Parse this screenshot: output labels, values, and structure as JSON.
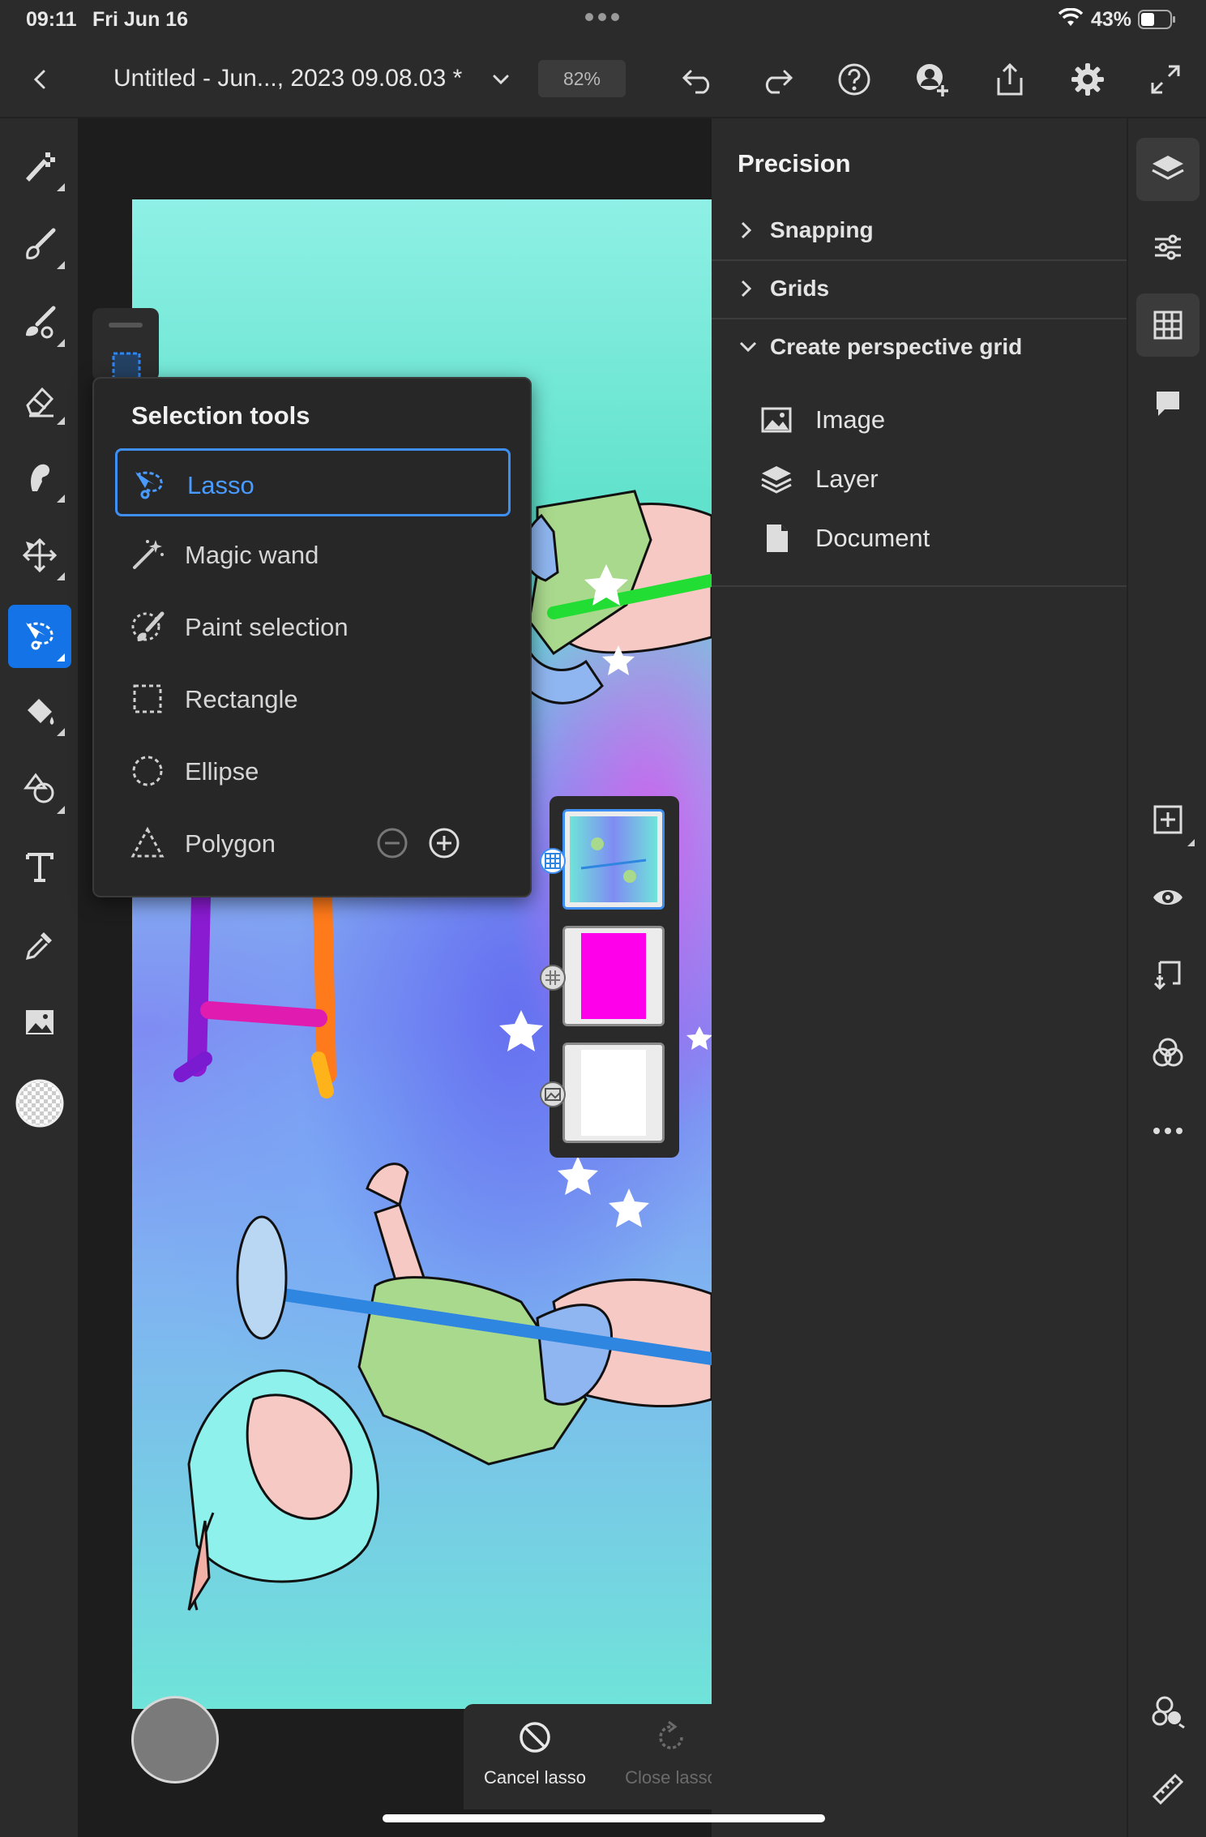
{
  "status_bar": {
    "time": "09:11",
    "date": "Fri Jun 16",
    "battery": "43%"
  },
  "toolbar": {
    "document_title": "Untitled - Jun..., 2023 09.08.03 *",
    "zoom": "82%"
  },
  "selection_tools": {
    "title": "Selection tools",
    "items": [
      {
        "label": "Lasso",
        "icon": "lasso-icon",
        "active": true
      },
      {
        "label": "Magic wand",
        "icon": "magic-wand-icon",
        "active": false
      },
      {
        "label": "Paint selection",
        "icon": "paint-selection-icon",
        "active": false
      },
      {
        "label": "Rectangle",
        "icon": "rectangle-select-icon",
        "active": false
      },
      {
        "label": "Ellipse",
        "icon": "ellipse-select-icon",
        "active": false
      },
      {
        "label": "Polygon",
        "icon": "polygon-select-icon",
        "active": false
      }
    ]
  },
  "precision": {
    "title": "Precision",
    "sections": [
      {
        "label": "Snapping",
        "expanded": false
      },
      {
        "label": "Grids",
        "expanded": false
      },
      {
        "label": "Create perspective grid",
        "expanded": true
      }
    ],
    "perspective_items": [
      {
        "label": "Image",
        "icon": "image-icon"
      },
      {
        "label": "Layer",
        "icon": "layers-icon"
      },
      {
        "label": "Document",
        "icon": "document-icon"
      }
    ]
  },
  "lasso_bar": {
    "cancel": "Cancel lasso",
    "close": "Close lasso"
  },
  "colors": {
    "accent": "#1473e6",
    "panel": "#2b2b2b",
    "canvas_bg": "#1d1d1d",
    "layer_magenta": "#ff00ea"
  }
}
